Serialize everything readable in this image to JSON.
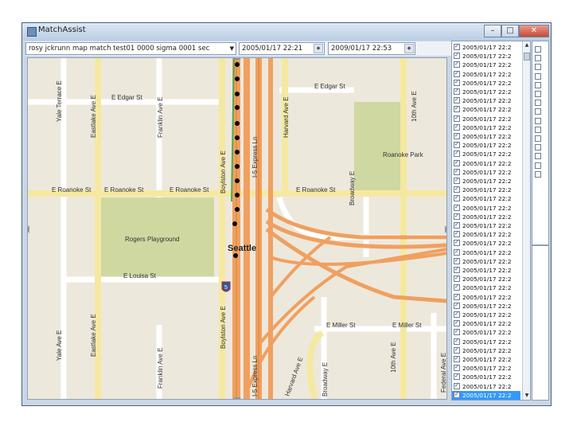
{
  "window": {
    "title": "MatchAssist",
    "minimize": "–",
    "maximize": "□",
    "close": "✕"
  },
  "toolbar": {
    "file_select": "rosy jckrunn map match test01 0000 sigma 0001 sec",
    "start_time": "2005/01/17 22:21",
    "end_time": "2009/01/17 22:53"
  },
  "map": {
    "streets": {
      "edgar": "E Edgar St",
      "edgar_east": "E Edgar St",
      "roanoke_w1": "E Roanoke St",
      "roanoke_w2": "E Roanoke St",
      "roanoke_w3": "E Roanoke St",
      "roanoke_e": "E Roanoke St",
      "louisa": "E Louisa St",
      "miller_1": "E Miller St",
      "miller_2": "E Miller St",
      "yale_top": "Yale Terrace E",
      "yale_bottom": "Yale Ave E",
      "eastlake_top": "Eastlake Ave E",
      "eastlake_bottom": "Eastlake Ave E",
      "franklin_top": "Franklin Ave E",
      "franklin_bottom": "Franklin Ave E",
      "boylston_top": "Boylston Ave E",
      "boylston_bottom": "Boylston Ave E",
      "i5_express_top": "I-5 Express Ln",
      "i5_express_bottom": "I-5 Express Ln",
      "harvard_top": "Harvard Ave E",
      "harvard_bottom": "Harvard Ave E",
      "broadway_top": "Broadway E",
      "broadway_bottom": "Broadway E",
      "tenth_top": "10th Ave E",
      "tenth_bottom": "10th Ave E",
      "federal": "Federal Ave E"
    },
    "parks": {
      "roanoke": "Roanoke Park",
      "rogers": "Rogers Playground"
    },
    "city": "Seattle",
    "shield": "5"
  },
  "list": {
    "items": [
      "2005/01/17 22:2",
      "2005/01/17 22:2",
      "2005/01/17 22:2",
      "2005/01/17 22:2",
      "2005/01/17 22:2",
      "2005/01/17 22:2",
      "2005/01/17 22:2",
      "2005/01/17 22:2",
      "2005/01/17 22:2",
      "2005/01/17 22:2",
      "2005/01/17 22:2",
      "2005/01/17 22:2",
      "2005/01/17 22:2",
      "2005/01/17 22:2",
      "2005/01/17 22:2",
      "2005/01/17 22:2",
      "2005/01/17 22:2",
      "2005/01/17 22:2",
      "2005/01/17 22:2",
      "2005/01/17 22:2",
      "2005/01/17 22:2",
      "2005/01/17 22:2",
      "2005/01/17 22:2",
      "2005/01/17 22:2",
      "2005/01/17 22:2",
      "2005/01/17 22:2",
      "2005/01/17 22:2",
      "2005/01/17 22:2",
      "2005/01/17 22:2",
      "2005/01/17 22:2",
      "2005/01/17 22:2",
      "2005/01/17 22:2",
      "2005/01/17 22:2",
      "2005/01/17 22:2",
      "2005/01/17 22:2",
      "2005/01/17 22:2",
      "2005/01/17 22:2",
      "2005/01/17 22:2",
      "2005/01/17 22:2",
      "2005/01/17 22:2"
    ],
    "selected_index": 39
  },
  "colors": {
    "highway": "#f0a060",
    "arterial": "#f8f0b0",
    "park": "#cfd8a0",
    "land": "#ede8dc",
    "track_point": "#000000",
    "selection": "#3399ff"
  }
}
